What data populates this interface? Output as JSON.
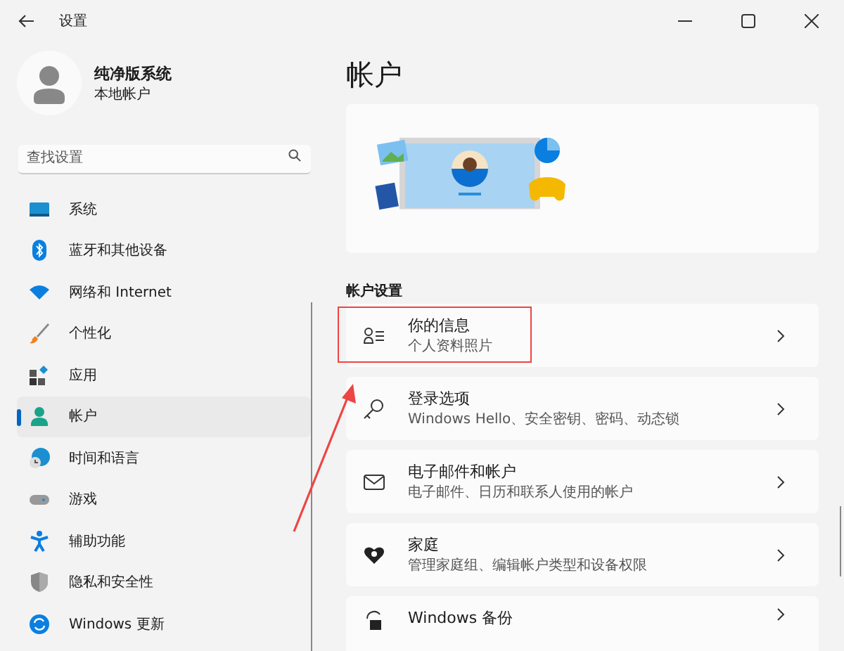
{
  "window": {
    "title": "设置"
  },
  "profile": {
    "name": "纯净版系统",
    "account_type": "本地帐户"
  },
  "search": {
    "placeholder": "查找设置"
  },
  "nav": [
    {
      "label": "系统",
      "selected": false
    },
    {
      "label": "蓝牙和其他设备",
      "selected": false
    },
    {
      "label": "网络和 Internet",
      "selected": false
    },
    {
      "label": "个性化",
      "selected": false
    },
    {
      "label": "应用",
      "selected": false
    },
    {
      "label": "帐户",
      "selected": true
    },
    {
      "label": "时间和语言",
      "selected": false
    },
    {
      "label": "游戏",
      "selected": false
    },
    {
      "label": "辅助功能",
      "selected": false
    },
    {
      "label": "隐私和安全性",
      "selected": false
    },
    {
      "label": "Windows 更新",
      "selected": false
    }
  ],
  "page_title": "帐户",
  "section_title": "帐户设置",
  "rows": [
    {
      "title": "你的信息",
      "subtitle": "个人资料照片",
      "highlighted": true
    },
    {
      "title": "登录选项",
      "subtitle": "Windows Hello、安全密钥、密码、动态锁",
      "highlighted": false
    },
    {
      "title": "电子邮件和帐户",
      "subtitle": "电子邮件、日历和联系人使用的帐户",
      "highlighted": false
    },
    {
      "title": "家庭",
      "subtitle": "管理家庭组、编辑帐户类型和设备权限",
      "highlighted": false
    },
    {
      "title": "Windows 备份",
      "highlighted": false
    }
  ]
}
